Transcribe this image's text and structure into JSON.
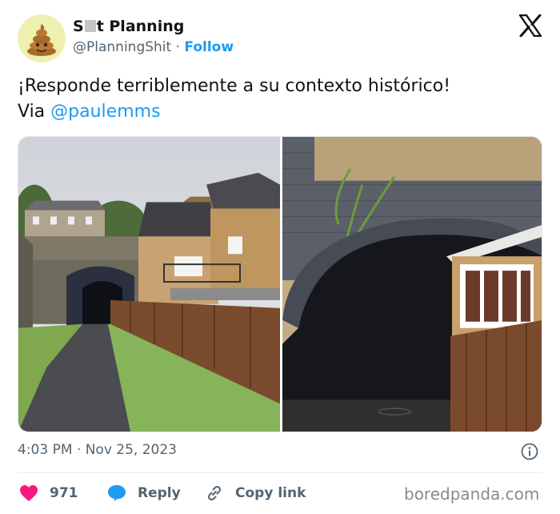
{
  "account": {
    "name_prefix": "S",
    "name_suffix": "t Planning",
    "handle": "@PlanningShit",
    "separator": "·",
    "follow_label": "Follow",
    "avatar_icon": "poop-emoji-icon"
  },
  "tweet": {
    "text_line1": "¡Responde terriblemente a su contexto histórico!",
    "via_label": "Via",
    "mention": "@paulemms"
  },
  "media": {
    "photos": [
      {
        "subject": "path leading to brick railway arch tunnel beside a house and wooden fence"
      },
      {
        "subject": "close-up of dark brick arch tunnel blocked beside house wall and wooden fence"
      }
    ]
  },
  "meta": {
    "timestamp": "4:03 PM · Nov 25, 2023"
  },
  "actions": {
    "like_count": "971",
    "reply_label": "Reply",
    "copy_label": "Copy link"
  },
  "watermark": "boredpanda.com",
  "colors": {
    "accent": "#1d9bf0",
    "like": "#f91880",
    "text": "#0f1419",
    "muted": "#536471"
  }
}
